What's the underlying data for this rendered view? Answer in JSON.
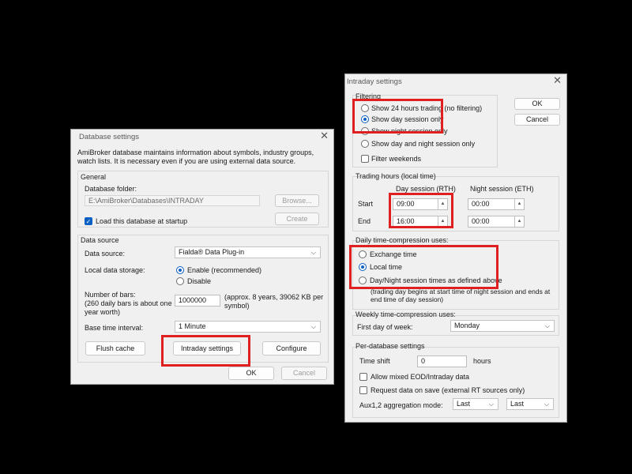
{
  "colors": {
    "background": "#000000",
    "highlight": "#e02020",
    "accent": "#0a5fc4"
  },
  "db": {
    "title": "Database settings",
    "close_icon": "close-icon",
    "intro": "AmiBroker database maintains information about symbols, industry groups, watch lists. It is necessary even if you are using external data source.",
    "general": {
      "label": "General",
      "folder_label": "Database folder:",
      "folder_value": "E:\\AmiBroker\\Databases\\INTRADAY",
      "browse": "Browse...",
      "load_label": "Load this database at startup",
      "load_checked": true,
      "create": "Create"
    },
    "datasource": {
      "label": "Data source",
      "source_label": "Data source:",
      "source_value": "Fialda® Data Plug-in",
      "storage_label": "Local data storage:",
      "enable": "Enable (recommended)",
      "disable": "Disable",
      "storage_selected": "enable",
      "bars_label": "Number of bars:",
      "bars_note": "(260 daily bars is about one year worth)",
      "bars_value": "1000000",
      "bars_info": "(approx. 8 years, 39062 KB per symbol)",
      "interval_label": "Base time interval:",
      "interval_value": "1 Minute",
      "flush": "Flush cache",
      "intraday": "Intraday settings",
      "configure": "Configure"
    },
    "ok": "OK",
    "cancel": "Cancel"
  },
  "intra": {
    "title": "Intraday settings",
    "ok": "OK",
    "cancel": "Cancel",
    "filtering": {
      "label": "Filtering",
      "opt_24h": "Show 24 hours trading (no filtering)",
      "opt_day": "Show day session only",
      "opt_night": "Show night session only",
      "opt_daynight": "Show day and night session only",
      "selected": "day",
      "weekends": "Filter weekends",
      "weekends_checked": false
    },
    "hours": {
      "label": "Trading hours (local time)",
      "day_header": "Day session (RTH)",
      "night_header": "Night session (ETH)",
      "start_label": "Start",
      "end_label": "End",
      "day_start": "09:00",
      "day_end": "16:00",
      "night_start": "00:00",
      "night_end": "00:00"
    },
    "daily": {
      "label": "Daily time-compression uses:",
      "exchange": "Exchange time",
      "local": "Local time",
      "session": "Day/Night session times as defined above",
      "selected": "local",
      "note": "(trading day begins at start time of night session and ends at end time of day session)"
    },
    "weekly": {
      "label": "Weekly time-compression uses:",
      "first_day_label": "First day of week:",
      "first_day_value": "Monday"
    },
    "perdb": {
      "label": "Per-database settings",
      "shift_label": "Time shift",
      "shift_value": "0",
      "shift_unit": "hours",
      "mixed": "Allow mixed EOD/Intraday data",
      "mixed_checked": false,
      "request": "Request data on save (external RT sources only)",
      "request_checked": false,
      "aux_label": "Aux1,2 aggregation mode:",
      "aux1": "Last",
      "aux2": "Last"
    }
  }
}
